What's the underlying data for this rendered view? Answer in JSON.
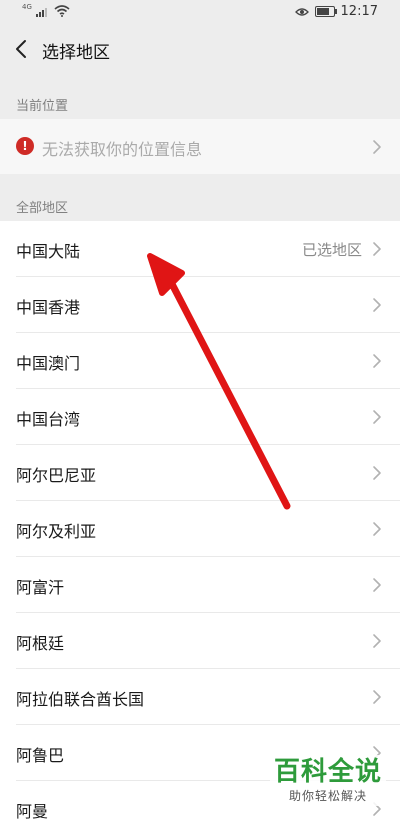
{
  "status_bar": {
    "signal_tag": "4G",
    "time": "12:17",
    "icons": [
      "signal-icon",
      "wifi-icon",
      "eye-icon",
      "battery-icon"
    ]
  },
  "nav": {
    "title": "选择地区",
    "back_icon": "chevron-left-icon"
  },
  "current_location": {
    "section_label": "当前位置",
    "text": "无法获取你的位置信息",
    "icon": "warning-icon",
    "icon_glyph": "!"
  },
  "all_regions": {
    "section_label": "全部地区",
    "items": [
      {
        "name": "中国大陆",
        "note": "已选地区"
      },
      {
        "name": "中国香港",
        "note": ""
      },
      {
        "name": "中国澳门",
        "note": ""
      },
      {
        "name": "中国台湾",
        "note": ""
      },
      {
        "name": "阿尔巴尼亚",
        "note": ""
      },
      {
        "name": "阿尔及利亚",
        "note": ""
      },
      {
        "name": "阿富汗",
        "note": ""
      },
      {
        "name": "阿根廷",
        "note": ""
      },
      {
        "name": "阿拉伯联合酋长国",
        "note": ""
      },
      {
        "name": "阿鲁巴",
        "note": ""
      },
      {
        "name": "阿曼",
        "note": ""
      }
    ]
  },
  "watermark": {
    "main": "百科全说",
    "sub": "助你轻松解决"
  },
  "colors": {
    "background": "#ededed",
    "row": "#ffffff",
    "warning": "#cf2b26",
    "arrow": "#e01515",
    "watermark": "#2e9b3b"
  }
}
